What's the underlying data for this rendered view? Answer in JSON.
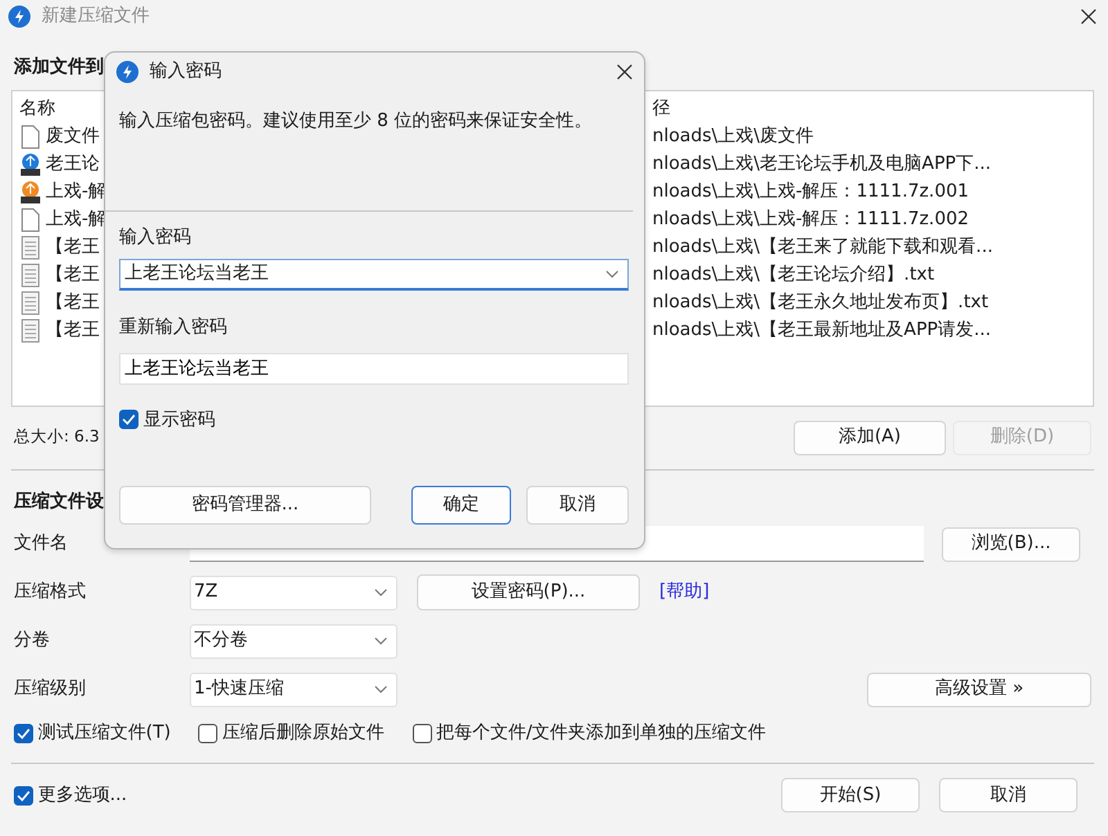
{
  "window": {
    "title": "新建压缩文件"
  },
  "add_section": {
    "heading": "添加文件到"
  },
  "file_list": {
    "columns": [
      "名称",
      "径"
    ],
    "rows": [
      {
        "name": "废文件",
        "kind": "file",
        "path": "nloads\\上戏\\废文件"
      },
      {
        "name": "老王论",
        "kind": "archive-blue",
        "path": "nloads\\上戏\\老王论坛手机及电脑APP下..."
      },
      {
        "name": "上戏-解",
        "kind": "archive-orange",
        "path": "nloads\\上戏\\上戏-解压：1111.7z.001"
      },
      {
        "name": "上戏-解",
        "kind": "file",
        "path": "nloads\\上戏\\上戏-解压：1111.7z.002"
      },
      {
        "name": "【老王",
        "kind": "text",
        "path": "nloads\\上戏\\【老王来了就能下载和观看..."
      },
      {
        "name": "【老王",
        "kind": "text",
        "path": "nloads\\上戏\\【老王论坛介绍】.txt"
      },
      {
        "name": "【老王",
        "kind": "text",
        "path": "nloads\\上戏\\【老王永久地址发布页】.txt"
      },
      {
        "name": "【老王",
        "kind": "text",
        "path": "nloads\\上戏\\【老王最新地址及APP请发..."
      }
    ]
  },
  "total_size": "总大小: 6.3",
  "list_buttons": [
    {
      "label": "添加(A)",
      "disabled": false
    },
    {
      "label": "删除(D)",
      "disabled": true
    }
  ],
  "settings": {
    "heading": "压缩文件设",
    "filename": {
      "label": "文件名"
    },
    "browse": "浏览(B)...",
    "format": {
      "label": "压缩格式",
      "value": "7Z"
    },
    "set_password": "设置密码(P)...",
    "help_link": "[帮助]",
    "volume": {
      "label": "分卷",
      "value": "不分卷"
    },
    "level": {
      "label": "压缩级别",
      "value": "1-快速压缩"
    },
    "advanced": "高级设置 »"
  },
  "options": [
    {
      "label": "测试压缩文件(T)",
      "checked": true
    },
    {
      "label": "压缩后删除原始文件",
      "checked": false
    },
    {
      "label": "把每个文件/文件夹添加到单独的压缩文件",
      "checked": false
    }
  ],
  "more_options": {
    "label": "更多选项...",
    "checked": true
  },
  "footer_buttons": [
    "开始(S)",
    "取消"
  ],
  "dialog": {
    "title": "输入密码",
    "message": "输入压缩包密码。建议使用至少 8 位的密码来保证安全性。",
    "password": {
      "label": "输入密码",
      "value": "上老王论坛当老王"
    },
    "confirm": {
      "label": "重新输入密码",
      "value": "上老王论坛当老王"
    },
    "show_password": {
      "label": "显示密码",
      "checked": true
    },
    "buttons": [
      {
        "label": "密码管理器...",
        "default": false
      },
      {
        "label": "确定",
        "default": true
      },
      {
        "label": "取消",
        "default": false
      }
    ]
  }
}
